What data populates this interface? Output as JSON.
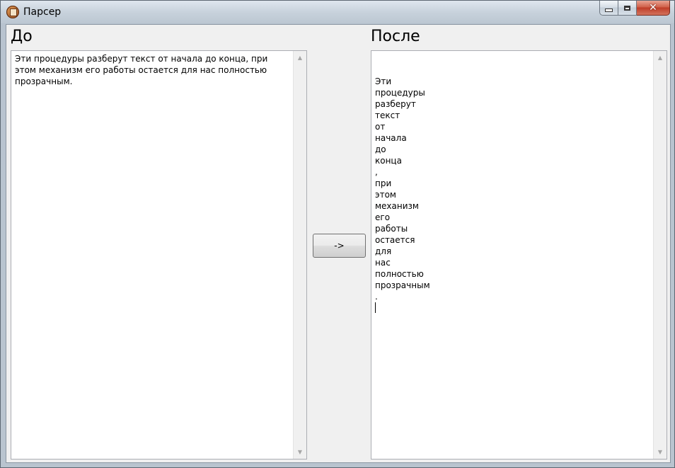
{
  "window": {
    "title": "Парсер"
  },
  "panels": {
    "before": {
      "heading": "До",
      "text": "Эти процедуры разберут текст от начала до конца, при\nэтом механизм его работы остается для нас полностью\nпрозрачным."
    },
    "after": {
      "heading": "После",
      "tokens": [
        "Эти",
        "процедуры",
        "разберут",
        "текст",
        "от",
        "начала",
        "до",
        "конца",
        ",",
        "при",
        "этом",
        "механизм",
        "его",
        "работы",
        "остается",
        "для",
        "нас",
        "полностью",
        "прозрачным",
        "."
      ]
    }
  },
  "convert_button": {
    "label": "->"
  },
  "icons": {
    "window_icon": "app-icon",
    "minimize": "minimize-icon",
    "maximize": "maximize-icon",
    "close": "close-icon",
    "scroll_up": "arrow-up-icon",
    "scroll_down": "arrow-down-icon"
  }
}
